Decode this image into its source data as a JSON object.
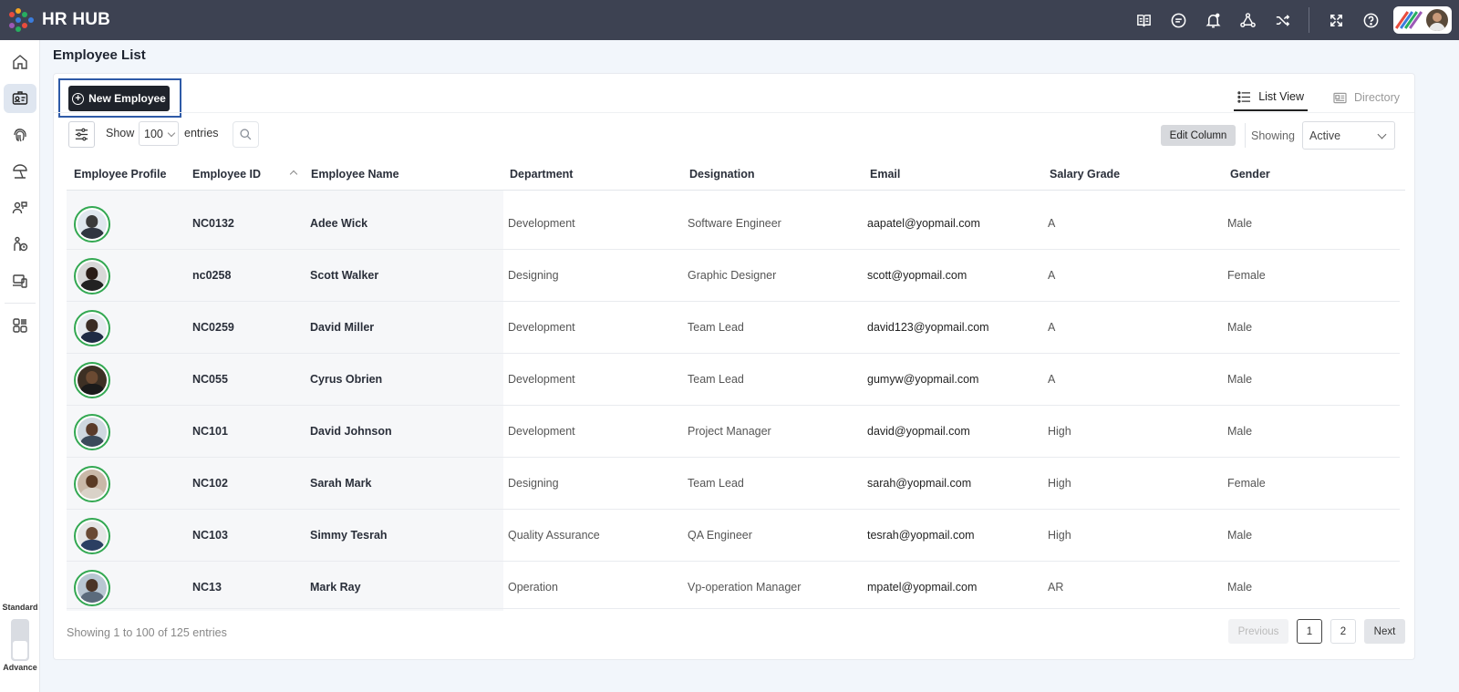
{
  "app": {
    "title": "HR HUB",
    "brand_dot_colors": [
      "#e84c3d",
      "#f5a623",
      "#27ae60",
      "#3b7ddd",
      "#9b59b6"
    ]
  },
  "topbar": {
    "icons": [
      "book-icon",
      "chat-icon",
      "bell-icon",
      "triangle-network-icon",
      "shuffle-icon",
      "expand-icon",
      "help-icon"
    ]
  },
  "sidebar": {
    "items": [
      "home-icon",
      "id-card-icon",
      "fingerprint-icon",
      "beach-umbrella-icon",
      "people-icon",
      "person-clock-icon",
      "devices-icon",
      "apps-icon"
    ],
    "active_index": 1,
    "mode_top": "Standard",
    "mode_bottom": "Advance"
  },
  "page": {
    "title": "Employee List"
  },
  "toolbar": {
    "new_employee_label": "New Employee",
    "show_label": "Show",
    "entries_value": "100",
    "entries_label": "entries",
    "edit_column_label": "Edit Column",
    "showing_label": "Showing",
    "status_value": "Active"
  },
  "views": {
    "list_view": "List View",
    "directory": "Directory",
    "active": "List View"
  },
  "table": {
    "columns": [
      "Employee Profile",
      "Employee ID",
      "Employee Name",
      "Department",
      "Designation",
      "Email",
      "Salary Grade",
      "Gender"
    ],
    "rows": [
      {
        "id": "NC0132",
        "name": "Adee Wick",
        "department": "Development",
        "designation": "Software Engineer",
        "email": "aapatel@yopmail.com",
        "grade": "A",
        "gender": "Male"
      },
      {
        "id": "nc0258",
        "name": "Scott Walker",
        "department": "Designing",
        "designation": "Graphic Designer",
        "email": "scott@yopmail.com",
        "grade": "A",
        "gender": "Female"
      },
      {
        "id": "NC0259",
        "name": "David Miller",
        "department": "Development",
        "designation": "Team Lead",
        "email": "david123@yopmail.com",
        "grade": "A",
        "gender": "Male"
      },
      {
        "id": "NC055",
        "name": "Cyrus Obrien",
        "department": "Development",
        "designation": "Team Lead",
        "email": "gumyw@yopmail.com",
        "grade": "A",
        "gender": "Male"
      },
      {
        "id": "NC101",
        "name": "David Johnson",
        "department": "Development",
        "designation": "Project Manager",
        "email": "david@yopmail.com",
        "grade": "High",
        "gender": "Male"
      },
      {
        "id": "NC102",
        "name": "Sarah Mark",
        "department": "Designing",
        "designation": "Team Lead",
        "email": "sarah@yopmail.com",
        "grade": "High",
        "gender": "Female"
      },
      {
        "id": "NC103",
        "name": "Simmy Tesrah",
        "department": "Quality Assurance",
        "designation": "QA Engineer",
        "email": "tesrah@yopmail.com",
        "grade": "High",
        "gender": "Male"
      },
      {
        "id": "NC13",
        "name": "Mark Ray",
        "department": "Operation",
        "designation": "Vp-operation Manager",
        "email": "mpatel@yopmail.com",
        "grade": "AR",
        "gender": "Male"
      }
    ]
  },
  "footer": {
    "info": "Showing 1 to 100 of 125 entries",
    "previous": "Previous",
    "pages": [
      "1",
      "2"
    ],
    "current_page": "1",
    "next": "Next"
  }
}
